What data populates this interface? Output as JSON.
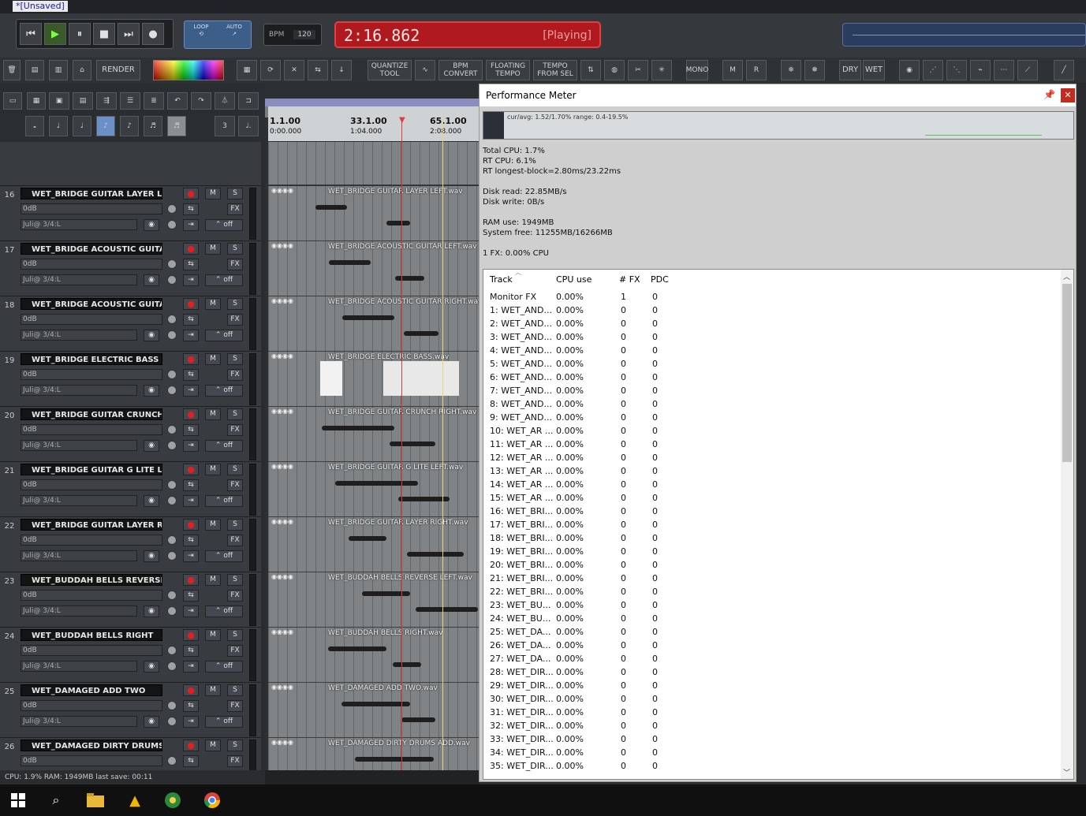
{
  "window": {
    "tab_title": "*[Unsaved]"
  },
  "transport": {
    "buttons": [
      "skip-start",
      "play",
      "pause",
      "stop",
      "skip-end",
      "record"
    ],
    "loop_label": "LOOP",
    "auto_label": "AUTO",
    "bpm_label": "BPM",
    "bpm_value": "120",
    "time": "2:16.862",
    "state": "[Playing]"
  },
  "toolbar": {
    "render_label": "RENDER",
    "quantize_line1": "QUANTIZE",
    "quantize_line2": "TOOL",
    "bpm_line1": "BPM",
    "bpm_line2": "CONVERT",
    "floating_line1": "FLOATING",
    "floating_line2": "TEMPO",
    "tempo_line1": "TEMPO",
    "tempo_line2": "FROM SEL",
    "dry_label": "DRY",
    "wet_label": "WET",
    "mono_label": "MONO"
  },
  "ruler": {
    "markers": [
      {
        "bar": "1.1.00",
        "time": "0:00.000"
      },
      {
        "bar": "33.1.00",
        "time": "1:04.000"
      },
      {
        "bar": "65.1.00",
        "time": "2:08.000"
      }
    ]
  },
  "track_defaults": {
    "volume": "0dB",
    "pan": "Juli@ 3/4:L",
    "m": "M",
    "s": "S",
    "fx": "FX",
    "off": "off"
  },
  "tracks": [
    {
      "num": "16",
      "name": "WET_BRIDGE GUITAR LAYER LEF",
      "item": "WET_BRIDGE GUITAR LAYER LEFT.wav"
    },
    {
      "num": "17",
      "name": "WET_BRIDGE ACOUSTIC GUITAR",
      "item": "WET_BRIDGE ACOUSTIC GUITAR LEFT.wav"
    },
    {
      "num": "18",
      "name": "WET_BRIDGE ACOUSTIC GUITAR",
      "item": "WET_BRIDGE ACOUSTIC GUITAR RIGHT.wav"
    },
    {
      "num": "19",
      "name": "WET_BRIDGE ELECTRIC BASS",
      "item": "WET_BRIDGE ELECTRIC BASS.wav"
    },
    {
      "num": "20",
      "name": "WET_BRIDGE GUITAR CRUNCH R",
      "item": "WET_BRIDGE GUITAR CRUNCH RIGHT.wav"
    },
    {
      "num": "21",
      "name": "WET_BRIDGE GUITAR G LITE LEF",
      "item": "WET_BRIDGE GUITAR G LITE LEFT.wav"
    },
    {
      "num": "22",
      "name": "WET_BRIDGE GUITAR LAYER RIG",
      "item": "WET_BRIDGE GUITAR LAYER RIGHT.wav"
    },
    {
      "num": "23",
      "name": "WET_BUDDAH BELLS REVERSE LE",
      "item": "WET_BUDDAH BELLS REVERSE LEFT.wav"
    },
    {
      "num": "24",
      "name": "WET_BUDDAH BELLS RIGHT",
      "item": "WET_BUDDAH BELLS RIGHT.wav"
    },
    {
      "num": "25",
      "name": "WET_DAMAGED ADD TWO",
      "item": "WET_DAMAGED ADD TWO.wav"
    },
    {
      "num": "26",
      "name": "WET_DAMAGED DIRTY DRUMS AI",
      "item": "WET_DAMAGED DIRTY DRUMS ADD.wav"
    }
  ],
  "status": {
    "text": "CPU: 1.9%   RAM: 1949MB   last save: 00:11"
  },
  "perf": {
    "title": "Performance Meter",
    "graph_label": "cur/avg: 1.52/1.70%   range: 0.4-19.5%",
    "stats": [
      "Total CPU: 1.7%",
      "RT CPU: 6.1%",
      "RT longest-block=2.80ms/23.22ms",
      "",
      "Disk read: 22.85MB/s",
      "Disk write: 0B/s",
      "",
      "RAM use: 1949MB",
      "System free: 11255MB/16266MB",
      "",
      "1 FX: 0.00% CPU"
    ],
    "columns": [
      "Track",
      "CPU use",
      "# FX",
      "PDC"
    ],
    "rows": [
      [
        "Monitor FX",
        "0.00%",
        "1",
        "0"
      ],
      [
        "1: WET_AND...",
        "0.00%",
        "0",
        "0"
      ],
      [
        "2: WET_AND...",
        "0.00%",
        "0",
        "0"
      ],
      [
        "3: WET_AND...",
        "0.00%",
        "0",
        "0"
      ],
      [
        "4: WET_AND...",
        "0.00%",
        "0",
        "0"
      ],
      [
        "5: WET_AND...",
        "0.00%",
        "0",
        "0"
      ],
      [
        "6: WET_AND...",
        "0.00%",
        "0",
        "0"
      ],
      [
        "7: WET_AND...",
        "0.00%",
        "0",
        "0"
      ],
      [
        "8: WET_AND...",
        "0.00%",
        "0",
        "0"
      ],
      [
        "9: WET_AND...",
        "0.00%",
        "0",
        "0"
      ],
      [
        "10: WET_AR ...",
        "0.00%",
        "0",
        "0"
      ],
      [
        "11: WET_AR ...",
        "0.00%",
        "0",
        "0"
      ],
      [
        "12: WET_AR ...",
        "0.00%",
        "0",
        "0"
      ],
      [
        "13: WET_AR ...",
        "0.00%",
        "0",
        "0"
      ],
      [
        "14: WET_AR ...",
        "0.00%",
        "0",
        "0"
      ],
      [
        "15: WET_AR ...",
        "0.00%",
        "0",
        "0"
      ],
      [
        "16: WET_BRI...",
        "0.00%",
        "0",
        "0"
      ],
      [
        "17: WET_BRI...",
        "0.00%",
        "0",
        "0"
      ],
      [
        "18: WET_BRI...",
        "0.00%",
        "0",
        "0"
      ],
      [
        "19: WET_BRI...",
        "0.00%",
        "0",
        "0"
      ],
      [
        "20: WET_BRI...",
        "0.00%",
        "0",
        "0"
      ],
      [
        "21: WET_BRI...",
        "0.00%",
        "0",
        "0"
      ],
      [
        "22: WET_BRI...",
        "0.00%",
        "0",
        "0"
      ],
      [
        "23: WET_BU...",
        "0.00%",
        "0",
        "0"
      ],
      [
        "24: WET_BU...",
        "0.00%",
        "0",
        "0"
      ],
      [
        "25: WET_DA...",
        "0.00%",
        "0",
        "0"
      ],
      [
        "26: WET_DA...",
        "0.00%",
        "0",
        "0"
      ],
      [
        "27: WET_DA...",
        "0.00%",
        "0",
        "0"
      ],
      [
        "28: WET_DIR...",
        "0.00%",
        "0",
        "0"
      ],
      [
        "29: WET_DIR...",
        "0.00%",
        "0",
        "0"
      ],
      [
        "30: WET_DIR...",
        "0.00%",
        "0",
        "0"
      ],
      [
        "31: WET_DIR...",
        "0.00%",
        "0",
        "0"
      ],
      [
        "32: WET_DIR...",
        "0.00%",
        "0",
        "0"
      ],
      [
        "33: WET_DIR...",
        "0.00%",
        "0",
        "0"
      ],
      [
        "34: WET_DIR...",
        "0.00%",
        "0",
        "0"
      ],
      [
        "35: WET_DIR...",
        "0.00%",
        "0",
        "0"
      ]
    ]
  }
}
